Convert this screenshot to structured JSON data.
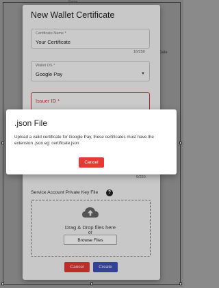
{
  "background": {
    "top_text": "Name",
    "date_label": "Date"
  },
  "form": {
    "title": "New Wallet Certificate",
    "certificate_name": {
      "label": "Certificate Name *",
      "value": "Your Certificate",
      "counter": "16/250"
    },
    "wallet_os": {
      "label": "Wallet OS *",
      "value": "Google Pay"
    },
    "issuer_id": {
      "label": "Issuer ID *",
      "counter": "0/250"
    },
    "private_key": {
      "label": "Service Account Private Key File"
    },
    "dropzone": {
      "line1": "Drag & Drop files here",
      "line2": "or",
      "browse_label": "Browse Files"
    },
    "cancel_label": "Cancel",
    "create_label": "Create"
  },
  "dialog": {
    "title": ".json File",
    "message": "Upload a valid certificate for Google Pay, these certificates must have the extension .json eg: certificate.json",
    "cancel_label": "Cancel"
  },
  "colors": {
    "danger": "#e53935",
    "primary": "#3f51b5",
    "error": "#d32f2f"
  },
  "icons": [
    "help-icon",
    "cloud-upload-icon",
    "chevron-down-icon"
  ]
}
